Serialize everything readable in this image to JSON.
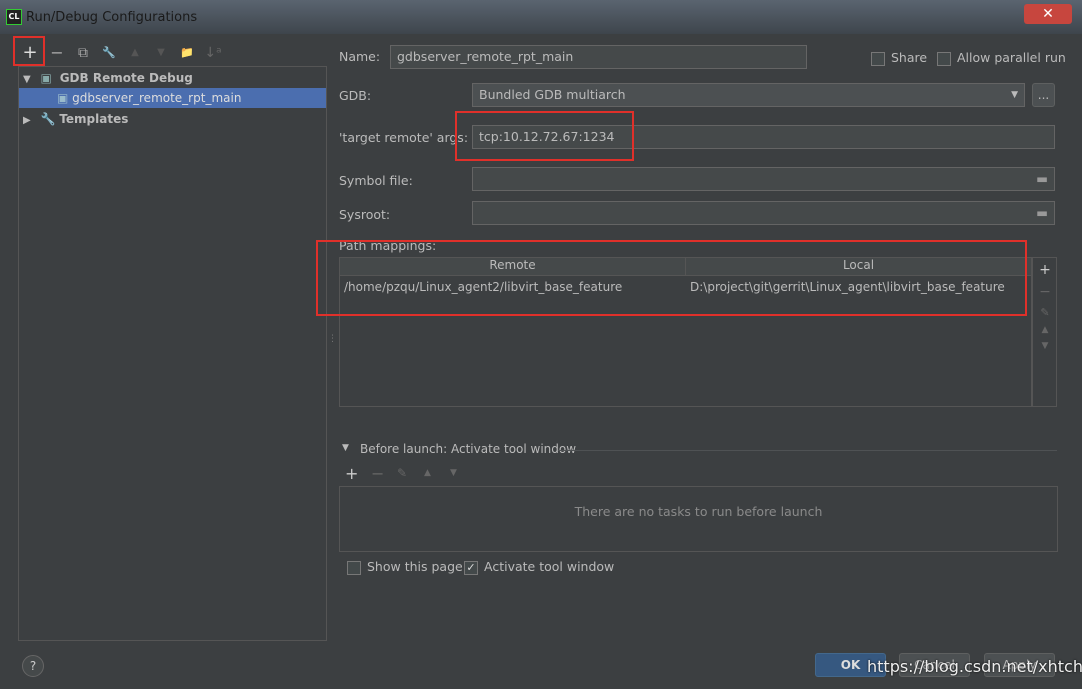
{
  "window": {
    "title": "Run/Debug Configurations",
    "logo": "CL",
    "close": "✕"
  },
  "toolbar": {
    "add": "+",
    "remove": "−",
    "copy": "⧉",
    "edit": "🔧",
    "up": "▲",
    "down": "▼",
    "folder": "📁",
    "sort": "↓ᵃ"
  },
  "tree": {
    "group": "GDB Remote Debug",
    "item": "gdbserver_remote_rpt_main",
    "templates": "Templates"
  },
  "form": {
    "name_label": "Name:",
    "name_value": "gdbserver_remote_rpt_main",
    "share": "Share",
    "allow_parallel": "Allow parallel run",
    "gdb_label": "GDB:",
    "gdb_value": "Bundled GDB multiarch",
    "browse": "...",
    "target_label": "'target remote' args:",
    "target_value": "tcp:10.12.72.67:1234",
    "symbol_label": "Symbol file:",
    "sysroot_label": "Sysroot:",
    "path_label": "Path mappings:"
  },
  "mappings": {
    "columns": [
      "Remote",
      "Local"
    ],
    "rows": [
      [
        "/home/pzqu/Linux_agent2/libvirt_base_feature",
        "D:\\project\\git\\gerrit\\Linux_agent\\libvirt_base_feature"
      ]
    ]
  },
  "before_launch": {
    "title": "Before launch: Activate tool window",
    "empty": "There are no tasks to run before launch",
    "show_page": "Show this page",
    "activate": "Activate tool window",
    "show_page_checked": false,
    "activate_checked": true
  },
  "buttons": {
    "help": "?",
    "ok": "OK",
    "cancel": "Cancel",
    "apply": "Apply"
  },
  "watermark": "https://blog.csdn.net/xhtchina"
}
